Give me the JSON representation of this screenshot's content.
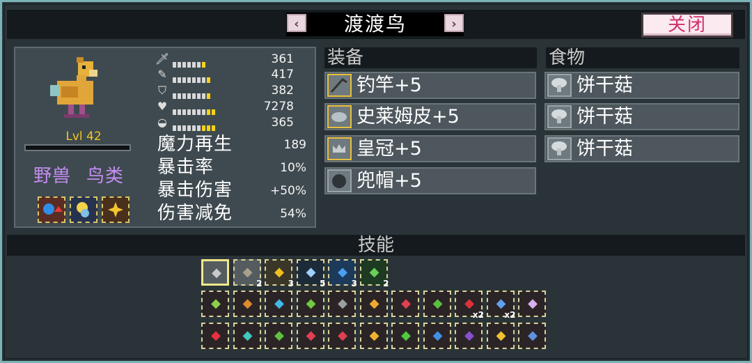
{
  "header": {
    "title": "渡渡鸟",
    "prev_icon": "‹",
    "next_icon": "›",
    "close_label": "关闭"
  },
  "pet": {
    "level_text": "Lvl 42",
    "types": [
      "野兽",
      "鸟类"
    ],
    "xp_fraction": 0.0,
    "stats": [
      {
        "icon": "sword-icon",
        "value": "361"
      },
      {
        "icon": "wand-icon",
        "value": "417"
      },
      {
        "icon": "shield-icon",
        "value": "382"
      },
      {
        "icon": "heart-icon",
        "value": "7278"
      },
      {
        "icon": "speed-icon",
        "value": "365"
      }
    ],
    "extra_stats": [
      {
        "label": "魔力再生",
        "value": "189"
      },
      {
        "label": "暴击率",
        "value": "10%"
      },
      {
        "label": "暴击伤害",
        "value": "+50%"
      },
      {
        "label": "伤害减免",
        "value": "54%"
      }
    ]
  },
  "equipment": {
    "title": "装备",
    "items": [
      {
        "label": "钓竿+5",
        "icon": "fishing-rod-icon"
      },
      {
        "label": "史莱姆皮+5",
        "icon": "slime-skin-icon"
      },
      {
        "label": "皇冠+5",
        "icon": "crown-icon"
      },
      {
        "label": "兜帽+5",
        "icon": "hood-icon"
      }
    ]
  },
  "food": {
    "title": "食物",
    "items": [
      {
        "label": "饼干菇",
        "icon": "mushroom-icon"
      },
      {
        "label": "饼干菇",
        "icon": "mushroom-icon"
      },
      {
        "label": "饼干菇",
        "icon": "mushroom-icon"
      }
    ]
  },
  "skills": {
    "title": "技能",
    "row1": [
      {
        "count": ""
      },
      {
        "count": "2"
      },
      {
        "count": "3"
      },
      {
        "count": "5"
      },
      {
        "count": "3"
      },
      {
        "count": "2"
      }
    ],
    "row2": [
      {
        "count": ""
      },
      {
        "count": ""
      },
      {
        "count": ""
      },
      {
        "count": ""
      },
      {
        "count": ""
      },
      {
        "count": ""
      },
      {
        "count": ""
      },
      {
        "count": ""
      },
      {
        "count": "x2"
      },
      {
        "count": "x2"
      },
      {
        "count": ""
      }
    ],
    "row3": [
      {
        "count": ""
      },
      {
        "count": ""
      },
      {
        "count": ""
      },
      {
        "count": ""
      },
      {
        "count": ""
      },
      {
        "count": ""
      },
      {
        "count": ""
      },
      {
        "count": ""
      },
      {
        "count": ""
      },
      {
        "count": ""
      },
      {
        "count": ""
      }
    ]
  }
}
